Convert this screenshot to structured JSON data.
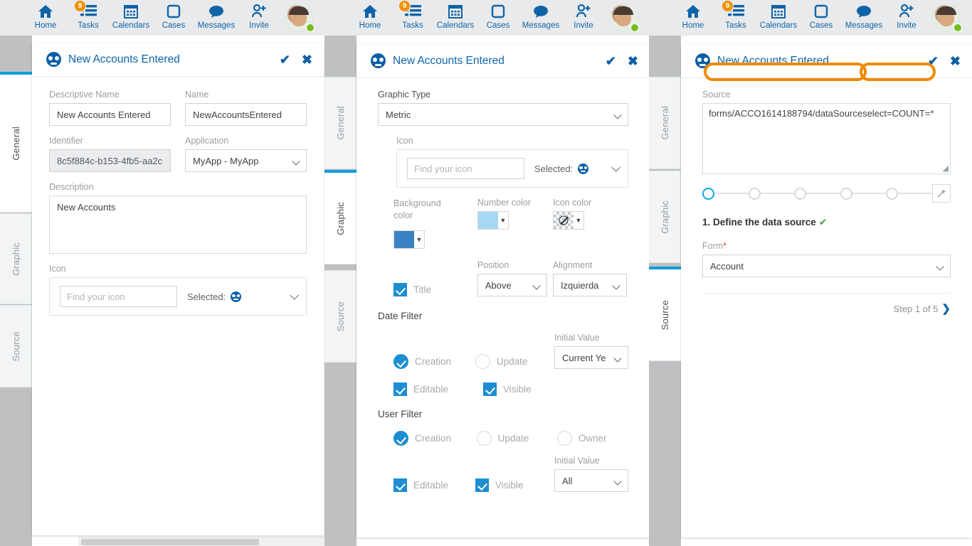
{
  "nav": {
    "items": [
      {
        "label": "Home",
        "icon": "home-icon",
        "badge": null
      },
      {
        "label": "Tasks",
        "icon": "tasks-icon",
        "badge": "9"
      },
      {
        "label": "Calendars",
        "icon": "calendar-icon",
        "badge": null
      },
      {
        "label": "Cases",
        "icon": "cases-icon",
        "badge": null
      },
      {
        "label": "Messages",
        "icon": "messages-icon",
        "badge": null
      },
      {
        "label": "Invite",
        "icon": "invite-icon",
        "badge": null
      }
    ]
  },
  "colors": {
    "brand_blue": "#0f64a8",
    "accent_blue": "#0f9cdd",
    "checkbox_blue": "#1d8ed1",
    "badge_orange": "#f29100",
    "highlight_orange": "#ef8b00",
    "background_color_swatch": "#3b82c4",
    "number_color_swatch": "#a5d8f3",
    "icon_color_swatch": "transparent",
    "ok_green": "#3f9c35",
    "required_red": "#e8493b"
  },
  "tabs": {
    "general": "General",
    "graphic": "Graphic",
    "source": "Source"
  },
  "panel1": {
    "title": "New Accounts Entered",
    "active_tab": "General",
    "confirm": "✔",
    "close": "✖",
    "descriptive_name": {
      "label": "Descriptive Name",
      "value": "New Accounts Entered"
    },
    "name": {
      "label": "Name",
      "value": "NewAccountsEntered"
    },
    "identifier": {
      "label": "Identifier",
      "value": "8c5f884c-b153-4fb5-aa2c"
    },
    "application": {
      "label": "Application",
      "value": "MyApp - MyApp"
    },
    "description": {
      "label": "Description",
      "value": "New Accounts"
    },
    "icon": {
      "label": "Icon",
      "placeholder": "Find your icon",
      "selected_label": "Selected:"
    }
  },
  "panel2": {
    "title": "New Accounts Entered",
    "active_tab": "Graphic",
    "confirm": "✔",
    "close": "✖",
    "graphic_type": {
      "label": "Graphic Type",
      "value": "Metric"
    },
    "icon": {
      "label": "Icon",
      "placeholder": "Find your icon",
      "selected_label": "Selected:"
    },
    "background_color": {
      "label": "Background color"
    },
    "number_color": {
      "label": "Number color"
    },
    "icon_color": {
      "label": "Icon color"
    },
    "title_checkbox": {
      "label": "Title",
      "checked": true
    },
    "position": {
      "label": "Position",
      "value": "Above"
    },
    "alignment": {
      "label": "Alignment",
      "value": "Izquierda"
    },
    "date_filter": {
      "heading": "Date Filter",
      "creation": {
        "label": "Creation",
        "checked": true
      },
      "update": {
        "label": "Update",
        "checked": false
      },
      "initial_value_label": "Initial Value",
      "initial_value": "Current Ye",
      "editable": {
        "label": "Editable",
        "checked": true
      },
      "visible": {
        "label": "Visible",
        "checked": true
      }
    },
    "user_filter": {
      "heading": "User Filter",
      "creation": {
        "label": "Creation",
        "checked": true
      },
      "update": {
        "label": "Update",
        "checked": false
      },
      "owner": {
        "label": "Owner",
        "checked": false
      },
      "initial_value_label": "Initial Value",
      "initial_value": "All",
      "editable": {
        "label": "Editable",
        "checked": true
      },
      "visible": {
        "label": "Visible",
        "checked": true
      }
    }
  },
  "panel3": {
    "title": "New Accounts Entered",
    "active_tab": "Source",
    "confirm": "✔",
    "close": "✖",
    "source": {
      "label": "Source",
      "highlight_1": "forms/ACCO1614188794/dataSource",
      "highlight_2": "select=COUNT=*"
    },
    "stepper": {
      "steps": 5,
      "current": 1,
      "wand_icon": "magic-wand-icon"
    },
    "step_title": "1. Define the data source",
    "step_title_check": "✔",
    "form": {
      "label": "Form",
      "required": "*",
      "value": "Account"
    },
    "step_counter": "Step 1 of 5",
    "next_arrow": "❯"
  }
}
